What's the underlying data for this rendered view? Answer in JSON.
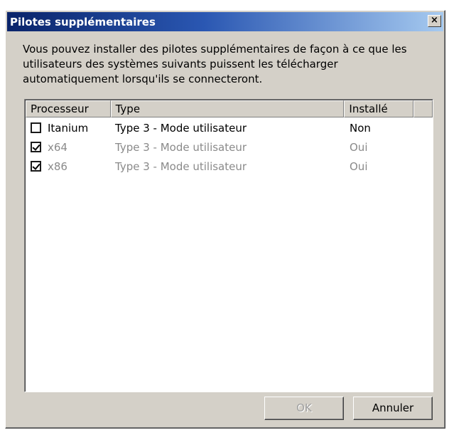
{
  "window": {
    "title": "Pilotes supplémentaires",
    "close_glyph": "×",
    "description": "Vous pouvez installer des pilotes supplémentaires de façon à ce que les utilisateurs des systèmes suivants puissent les télécharger automatiquement lorsqu'ils se connecteront."
  },
  "list": {
    "columns": [
      "Processeur",
      "Type",
      "Installé",
      ""
    ],
    "rows": [
      {
        "checked": false,
        "enabled": true,
        "processor": "Itanium",
        "type": "Type 3 - Mode utilisateur",
        "installed": "Non"
      },
      {
        "checked": true,
        "enabled": false,
        "processor": "x64",
        "type": "Type 3 - Mode utilisateur",
        "installed": "Oui"
      },
      {
        "checked": true,
        "enabled": false,
        "processor": "x86",
        "type": "Type 3 - Mode utilisateur",
        "installed": "Oui"
      }
    ]
  },
  "buttons": {
    "ok_label": "OK",
    "ok_enabled": false,
    "cancel_label": "Annuler"
  },
  "colors": {
    "titlebar_start": "#0a246a",
    "titlebar_end": "#a6caf0",
    "dialog_face": "#d4d0c8",
    "disabled_text": "#8a8a8a"
  },
  "icons": {
    "close": "close-icon",
    "checkbox_checked": "checkbox-checked-icon",
    "checkbox_unchecked": "checkbox-unchecked-icon"
  }
}
